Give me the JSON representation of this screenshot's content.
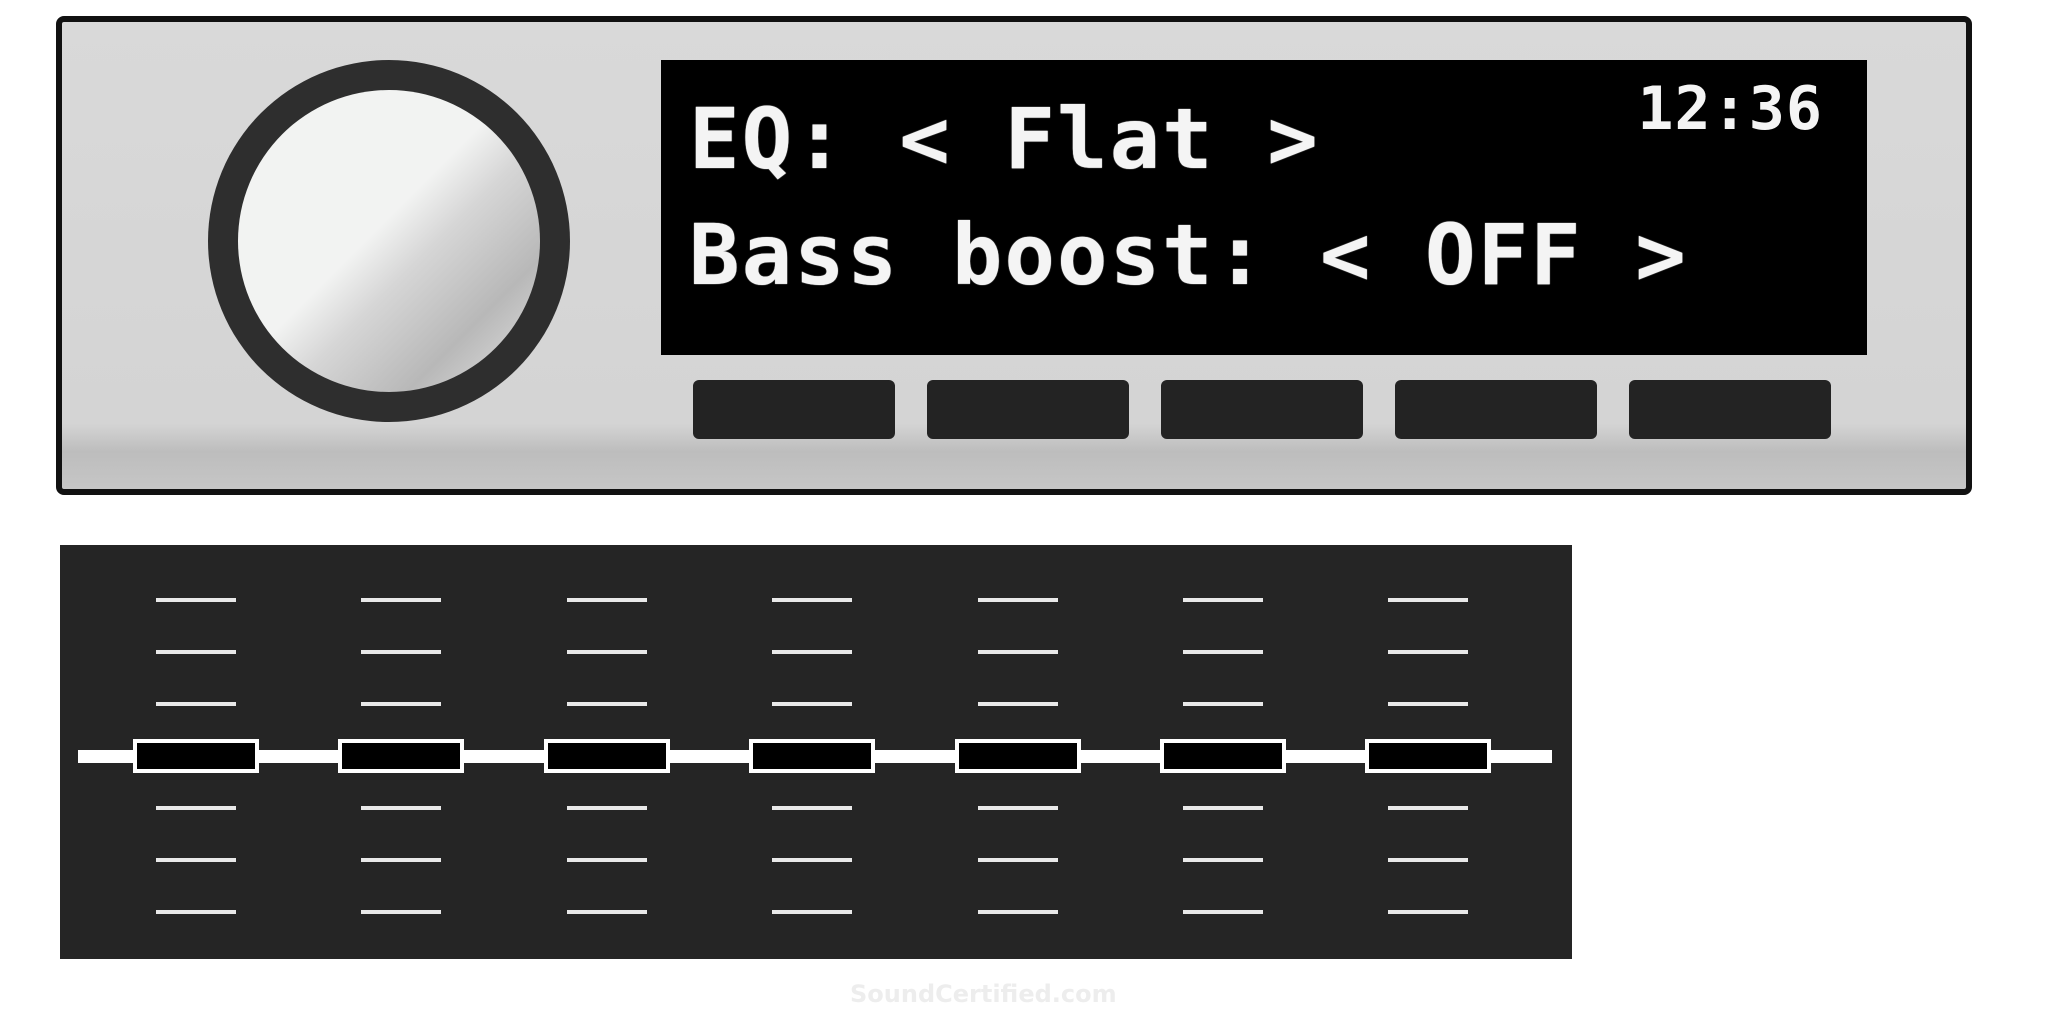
{
  "display": {
    "eq_line": "EQ: < Flat >",
    "bass_line": "Bass boost: < OFF >",
    "clock": "12:36"
  },
  "preset_buttons": [
    "",
    "",
    "",
    "",
    ""
  ],
  "equalizer": {
    "band_count": 7,
    "ticks_per_side": 3,
    "levels": [
      0,
      0,
      0,
      0,
      0,
      0,
      0
    ]
  },
  "watermark": "SoundCertified.com",
  "colors": {
    "body": "#d6d6d6",
    "display_bg": "#000000",
    "display_text": "#f4f4f4",
    "buttons": "#232323",
    "eq_panel": "#252525",
    "eq_line": "#ffffff"
  }
}
